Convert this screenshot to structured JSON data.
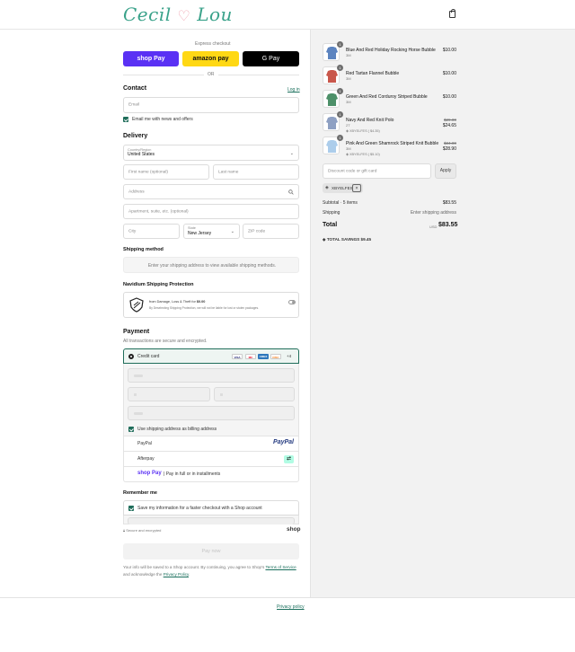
{
  "header": {
    "logo_left": "Cecil",
    "logo_heart": "♡",
    "logo_right": "Lou"
  },
  "express": {
    "label": "Express checkout",
    "shop_pay": "shop Pay",
    "amazon_pay": "amazon pay",
    "google_pay": "G Pay",
    "or": "OR"
  },
  "contact": {
    "title": "Contact",
    "login": "Log in",
    "email_placeholder": "Email",
    "news_label": "Email me with news and offers"
  },
  "delivery": {
    "title": "Delivery",
    "country_label": "Country/Region",
    "country_value": "United States",
    "first_name": "First name (optional)",
    "last_name": "Last name",
    "address": "Address",
    "apartment": "Apartment, suite, etc. (optional)",
    "city": "City",
    "state_label": "State",
    "state_value": "New Jersey",
    "zip": "ZIP code"
  },
  "shipping_method": {
    "title": "Shipping method",
    "message": "Enter your shipping address to view available shipping methods."
  },
  "protection": {
    "title": "Navidium Shipping Protection",
    "line1_prefix": "from Damage, Loss & Theft for",
    "line1_price": "$0.00",
    "line2": "By Deselecting Shipping Protection, we will not be liable for lost or stolen packages."
  },
  "payment": {
    "title": "Payment",
    "subtitle": "All transactions are secure and encrypted.",
    "credit_card": "Credit card",
    "card_logos": [
      "VISA",
      "MC",
      "AMEX",
      "DISC"
    ],
    "more": "+4",
    "billing_label": "Use shipping address as billing address",
    "paypal": "PayPal",
    "paypal_logo": "PayPal",
    "afterpay": "Afterpay",
    "shop_pay_logo": "shop Pay",
    "shop_pay_text": "| Pay in full or in installments"
  },
  "remember": {
    "title": "Remember me",
    "label": "Save my information for a faster checkout with a Shop account",
    "secure": "Secure and encrypted",
    "shop": "shop"
  },
  "pay_now": "Pay now",
  "legal": {
    "prefix": "Your info will be saved to a Shop account. By continuing, you agree to Shop's",
    "terms": "Terms of Service",
    "middle": "and acknowledge the",
    "privacy": "Privacy Policy",
    "suffix": "."
  },
  "footer": {
    "privacy_policy": "Privacy policy"
  },
  "cart": {
    "items": [
      {
        "name": "Blue And Red Holiday Rocking Horse Bubble",
        "variant": "3M",
        "qty": "1",
        "price": "$10.00",
        "orig": "",
        "discount": "",
        "color": "#3f6fb5"
      },
      {
        "name": "Red Tartan Flannel Bubble",
        "variant": "3M",
        "qty": "1",
        "price": "$10.00",
        "orig": "",
        "discount": "",
        "color": "#c0392b"
      },
      {
        "name": "Green And Red Corduroy Striped Bubble",
        "variant": "3M",
        "qty": "1",
        "price": "$10.00",
        "orig": "",
        "discount": "",
        "color": "#2e7d4f"
      },
      {
        "name": "Navy And Red Knit Polo",
        "variant": "2T",
        "qty": "1",
        "price": "$24.65",
        "orig": "$29.00",
        "discount": "XBYELFES ( $4.35)",
        "color": "#7a8fb8"
      },
      {
        "name": "Pink And Green Shamrock Striped Knit Bubble",
        "variant": "3M",
        "qty": "1",
        "price": "$28.90",
        "orig": "$34.00",
        "discount": "XBYELFES ( $5.10)",
        "color": "#9ec4e8"
      }
    ],
    "discount_placeholder": "Discount code or gift card",
    "apply": "Apply",
    "applied_code": "XBYELFES",
    "subtotal_label": "Subtotal · 5 items",
    "subtotal_value": "$83.55",
    "shipping_label": "Shipping",
    "shipping_value": "Enter shipping address",
    "total_label": "Total",
    "currency": "USD",
    "total_value": "$83.55",
    "savings_label": "TOTAL SAVINGS",
    "savings_value": "$9.45"
  }
}
